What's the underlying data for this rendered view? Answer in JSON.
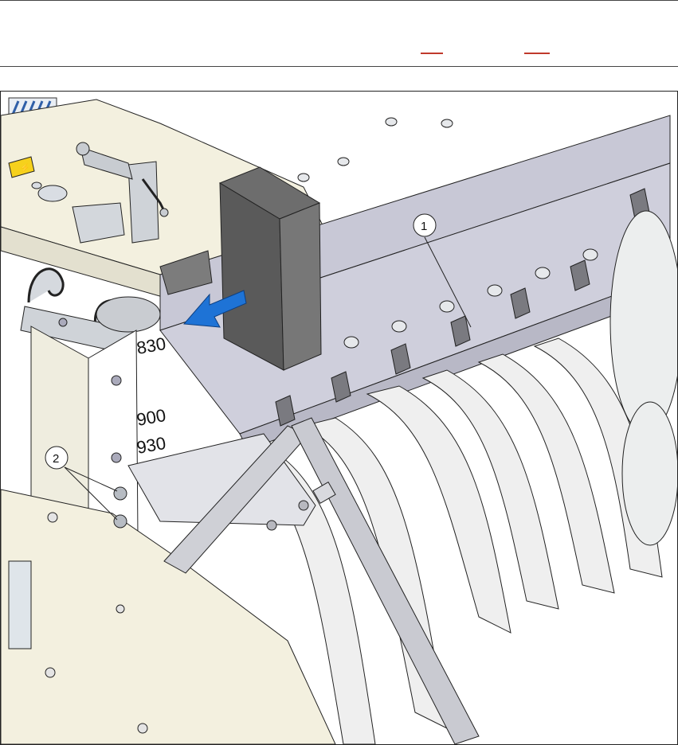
{
  "figure": {
    "callouts": [
      "1",
      "2"
    ],
    "scale_labels": [
      "830",
      "900",
      "930"
    ],
    "arrow_color": "#1e73d6",
    "arrow_direction": "left"
  }
}
